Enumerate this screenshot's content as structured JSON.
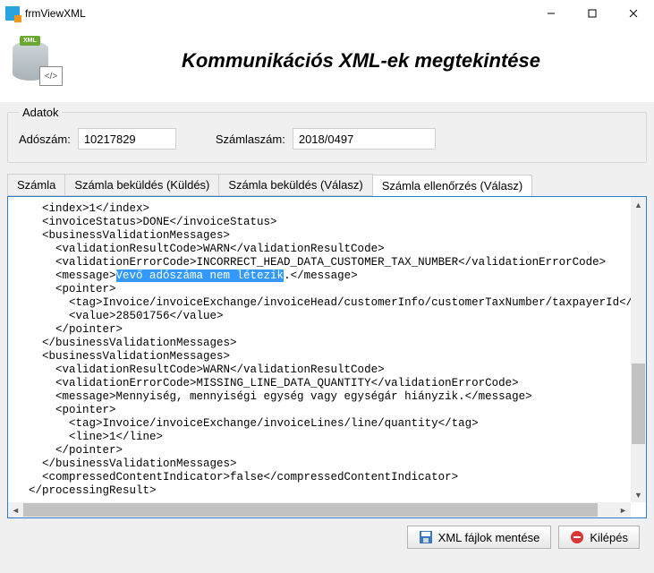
{
  "window": {
    "title": "frmViewXML"
  },
  "header": {
    "logo_tag": "XML",
    "logo_code": "</>",
    "title": "Kommunikációs XML-ek megtekintése"
  },
  "adatok": {
    "legend": "Adatok",
    "adoszam_label": "Adószám:",
    "adoszam_value": "10217829",
    "szamlaszam_label": "Számlaszám:",
    "szamlaszam_value": "2018/0497"
  },
  "tabs": [
    {
      "label": "Számla",
      "active": false
    },
    {
      "label": "Számla beküldés (Küldés)",
      "active": false
    },
    {
      "label": "Számla beküldés (Válasz)",
      "active": false
    },
    {
      "label": "Számla ellenőrzés (Válasz)",
      "active": true
    }
  ],
  "xml": {
    "lines": [
      "    <index>1</index>",
      "    <invoiceStatus>DONE</invoiceStatus>",
      "    <businessValidationMessages>",
      "      <validationResultCode>WARN</validationResultCode>",
      "      <validationErrorCode>INCORRECT_HEAD_DATA_CUSTOMER_TAX_NUMBER</validationErrorCode>",
      "",
      "      <pointer>",
      "        <tag>Invoice/invoiceExchange/invoiceHead/customerInfo/customerTaxNumber/taxpayerId</tag",
      "        <value>28501756</value>",
      "      </pointer>",
      "    </businessValidationMessages>",
      "    <businessValidationMessages>",
      "      <validationResultCode>WARN</validationResultCode>",
      "      <validationErrorCode>MISSING_LINE_DATA_QUANTITY</validationErrorCode>",
      "      <message>Mennyiség, mennyiségi egység vagy egységár hiányzik.</message>",
      "      <pointer>",
      "        <tag>Invoice/invoiceExchange/invoiceLines/line/quantity</tag>",
      "        <line>1</line>",
      "      </pointer>",
      "    </businessValidationMessages>",
      "    <compressedContentIndicator>false</compressedContentIndicator>",
      "  </processingResult>"
    ],
    "highlight_line_index": 5,
    "highlight_prefix": "      <message>",
    "highlight_text": "Vevő adószáma nem létezik",
    "highlight_suffix": ".</message>"
  },
  "footer": {
    "save_label": "XML fájlok mentése",
    "exit_label": "Kilépés"
  }
}
